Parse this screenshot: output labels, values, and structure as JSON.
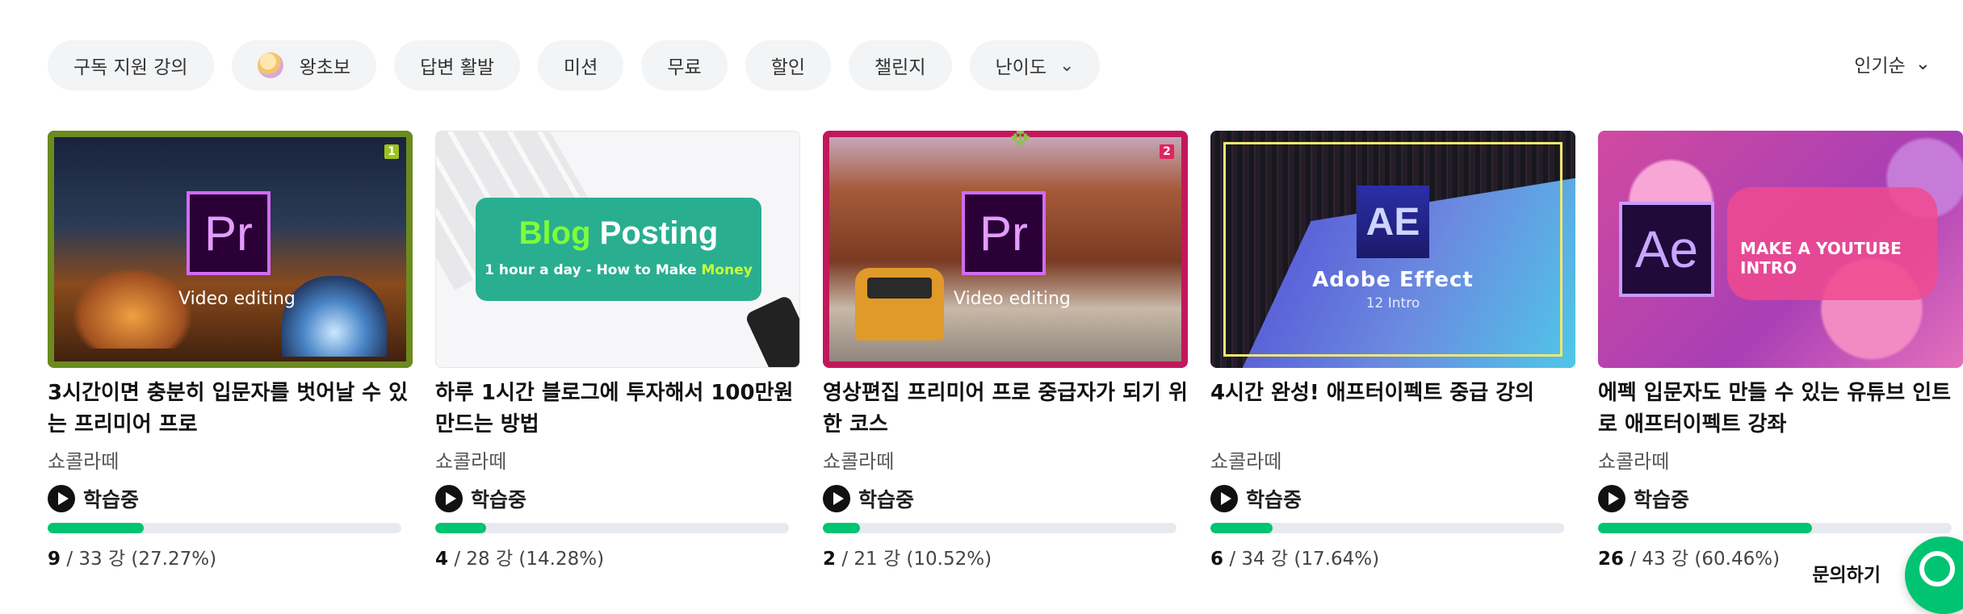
{
  "filters": [
    "구독 지원 강의",
    "왕초보",
    "답변 활발",
    "미션",
    "무료",
    "할인",
    "챌린지",
    "난이도"
  ],
  "sort": "인기순",
  "cards": [
    {
      "title": "3시간이면 충분히 입문자를 벗어날 수 있는 프리미어 프로",
      "author": "쇼콜라떼",
      "status": "학습중",
      "done": "9",
      "progress": " / 33 강 (27.27%)",
      "ratio": 0.2727,
      "logo": "Pr",
      "caption": "Video editing",
      "badge": "1"
    },
    {
      "title": "하루 1시간 블로그에 투자해서 100만원 만드는 방법",
      "author": "쇼콜라떼",
      "status": "학습중",
      "done": "4",
      "progress": " / 28 강 (14.28%)",
      "ratio": 0.1428,
      "blog_word": "Blog",
      "posting_word": "Posting",
      "sub_prefix": "1 hour a day - How to Make",
      "sub_money": "Money"
    },
    {
      "title": "영상편집 프리미어 프로 중급자가 되기 위한 코스",
      "author": "쇼콜라떼",
      "status": "학습중",
      "done": "2",
      "progress": " / 21 강 (10.52%)",
      "ratio": 0.1052,
      "logo": "Pr",
      "caption": "Video editing",
      "badge": "2"
    },
    {
      "title": "4시간 완성! 애프터이펙트 중급 강의",
      "author": "쇼콜라떼",
      "status": "학습중",
      "done": "6",
      "progress": " / 34 강 (17.64%)",
      "ratio": 0.1764,
      "logo": "AE",
      "caption": "Adobe Effect",
      "caption2": "12 Intro"
    },
    {
      "title": "에펙 입문자도 만들 수 있는 유튜브 인트로 애프터이펙트 강좌",
      "author": "쇼콜라떼",
      "status": "학습중",
      "done": "26",
      "progress": " / 43 강 (60.46%)",
      "ratio": 0.6046,
      "logo": "Ae",
      "caption": "MAKE A YOUTUBE INTRO"
    }
  ],
  "contact": "문의하기"
}
